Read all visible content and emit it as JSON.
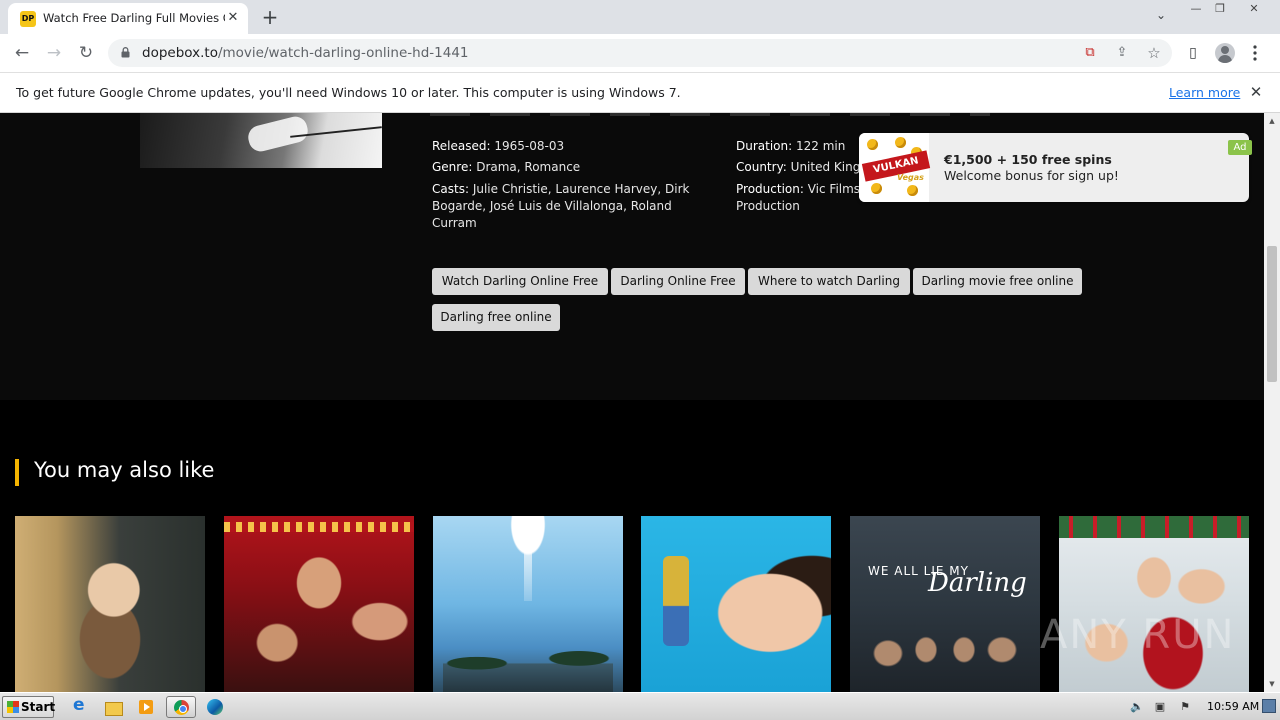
{
  "browser": {
    "tab": {
      "favicon_text": "DP",
      "title": "Watch Free Darling Full Movies Online",
      "close_glyph": "✕"
    },
    "new_tab_glyph": "+",
    "window_controls": {
      "minimize": "—",
      "restore": "❐",
      "close": "✕",
      "tab_search": "⌄"
    },
    "nav": {
      "back": "←",
      "forward": "→",
      "reload": "↻"
    },
    "url": {
      "host": "dopebox.to",
      "path": "/movie/watch-darling-online-hd-1441"
    },
    "omnibox_icons": [
      "cast-blocked-icon",
      "share-icon",
      "bookmark-star-icon"
    ],
    "omnibox_glyphs": {
      "cast": "⧉",
      "share": "⇪",
      "star": "☆"
    },
    "toolbar_glyphs": {
      "side_panel": "▯"
    }
  },
  "infobar": {
    "message": "To get future Google Chrome updates, you'll need Windows 10 or later. This computer is using Windows 7.",
    "link": "Learn more",
    "close_glyph": "✕"
  },
  "movie": {
    "released_label": "Released:",
    "released": "1965-08-03",
    "genre_label": "Genre:",
    "genre": "Drama, Romance",
    "casts_label": "Casts:",
    "casts": "Julie Christie, Laurence Harvey, Dirk Bogarde, José Luis de Villalonga, Roland Curram",
    "duration_label": "Duration:",
    "duration": "122 min",
    "country_label": "Country:",
    "country": "United Kingdom",
    "production_label": "Production:",
    "production": "Vic Films Productions, Joseph Janni Production",
    "tags": [
      "Watch Darling Online Free",
      "Darling Online Free",
      "Where to watch Darling",
      "Darling movie free online",
      "Darling free online"
    ]
  },
  "ad": {
    "logo_text": "VULKAN",
    "logo_sub": "Vegas",
    "title": "€1,500 + 150 free spins",
    "subtitle": "Welcome bonus for sign up!",
    "badge": "Ad"
  },
  "recommendations": {
    "heading": "You may also like",
    "items": [
      {
        "poster": "poster-woman-portrait"
      },
      {
        "poster": "poster-red-theatre"
      },
      {
        "poster": "poster-blue-sky-palms"
      },
      {
        "poster": "poster-face-on-blue"
      },
      {
        "poster": "poster-we-all-lie-my-darling",
        "title_small": "WE ALL LIE MY",
        "title_script": "Darling"
      },
      {
        "poster": "poster-christmas-family"
      }
    ]
  },
  "watermark": "ANY RUN",
  "scrollbar": {
    "up_glyph": "▲",
    "down_glyph": "▼"
  },
  "taskbar": {
    "start_label": "Start",
    "tray": {
      "volume": "🔈",
      "network": "▣",
      "flag": "⚑"
    },
    "clock": "10:59 AM"
  },
  "colors": {
    "accent": "#f5b400",
    "tag_bg": "#d9d9d9",
    "link": "#1a73e8",
    "ad_badge": "#8bc34a"
  }
}
